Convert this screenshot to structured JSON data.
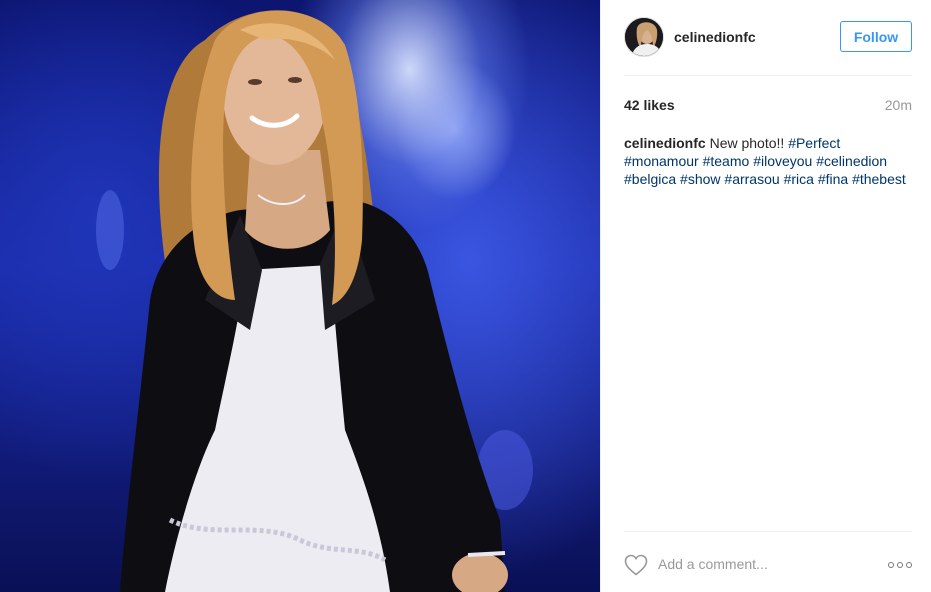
{
  "header": {
    "username": "celinedionfc",
    "follow_label": "Follow"
  },
  "stats": {
    "likes": "42 likes",
    "time": "20m"
  },
  "caption": {
    "user": "celinedionfc",
    "text": "New photo!!",
    "hashtags": [
      "#Perfect",
      "#monamour",
      "#teamo",
      "#iloveyou",
      "#celinedion",
      "#belgica",
      "#show",
      "#arrasou",
      "#rica",
      "#fina",
      "#thebest"
    ]
  },
  "comment": {
    "placeholder": "Add a comment..."
  },
  "icons": {
    "like": "heart-icon",
    "more": "more-options-icon"
  },
  "colors": {
    "accent": "#3897f0",
    "hashtag": "#003569",
    "muted": "#999999"
  }
}
